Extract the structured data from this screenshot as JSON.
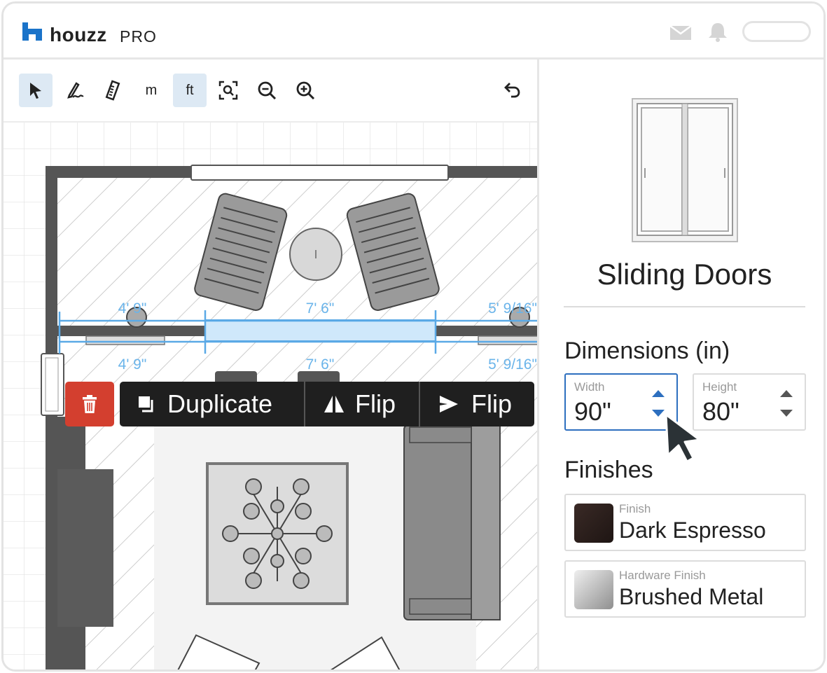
{
  "header": {
    "logo_text": "houzz",
    "logo_suffix": "PRO",
    "icons": [
      "mail-icon",
      "bell-icon"
    ]
  },
  "toolbar": {
    "tools": [
      "select-pointer-icon",
      "draw-pen-icon",
      "measure-ruler-icon",
      "m",
      "ft",
      "zoom-fit-icon",
      "zoom-out-icon",
      "zoom-in-icon",
      "undo-icon"
    ],
    "unit_m": "m",
    "unit_ft": "ft",
    "active_tools": [
      "select-pointer-icon",
      "ft"
    ]
  },
  "canvas": {
    "dimension_labels_top": [
      "4' 9\"",
      "7' 6\"",
      "5' 9/16\""
    ],
    "dimension_labels_bottom": [
      "4' 9\"",
      "7' 6\"",
      "5' 9/16\""
    ],
    "selection_color": "#5aa9e6"
  },
  "context_menu": {
    "delete_icon": "trash-icon",
    "duplicate_label": "Duplicate",
    "flip_vertical_label": "Flip",
    "flip_horizontal_label": "Flip",
    "delete_color": "#d33f2f",
    "bar_color": "#1f1f1f"
  },
  "panel": {
    "title": "Sliding Doors",
    "dimensions_heading": "Dimensions (in)",
    "width_label": "Width",
    "width_value": "90\"",
    "height_label": "Height",
    "height_value": "80\"",
    "finishes_heading": "Finishes",
    "finishes": [
      {
        "label": "Finish",
        "value": "Dark Espresso",
        "swatch_color": "#2a1e1c"
      },
      {
        "label": "Hardware Finish",
        "value": "Brushed Metal",
        "swatch_color": "#b8b8b8"
      }
    ],
    "accent_color": "#2d6fbf"
  }
}
